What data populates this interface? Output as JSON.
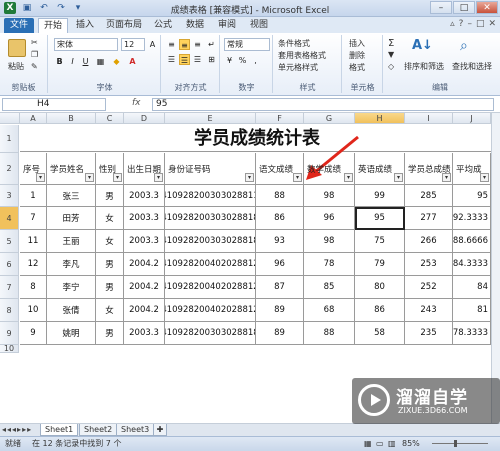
{
  "window": {
    "title": "成绩表格 [兼容模式] - Microsoft Excel",
    "minimize": "–",
    "restore": "□",
    "close": "✕"
  },
  "tabs": [
    "文件",
    "开始",
    "插入",
    "页面布局",
    "公式",
    "数据",
    "审阅",
    "视图"
  ],
  "ribbon": {
    "paste_label": "粘贴",
    "clipboard_group": "剪贴板",
    "font_name": "宋体",
    "font_size": "12",
    "font_group": "字体",
    "align_group": "对齐方式",
    "number_format": "常规",
    "number_group": "数字",
    "styles": [
      "条件格式",
      "套用表格格式",
      "单元格样式"
    ],
    "styles_group": "样式",
    "cells": [
      "插入",
      "删除",
      "格式"
    ],
    "cells_group": "单元格",
    "sort_label": "排序和筛选",
    "find_label": "查找和选择",
    "edit_group": "编辑"
  },
  "formula_bar": {
    "cell_ref": "H4",
    "fx": "fx",
    "value": "95"
  },
  "sheet": {
    "col_letters": [
      "A",
      "B",
      "C",
      "D",
      "E",
      "F",
      "G",
      "H",
      "I",
      "J"
    ],
    "row_numbers": [
      "1",
      "2",
      "3",
      "4",
      "5",
      "6",
      "7",
      "8",
      "9",
      "10"
    ],
    "title": "学员成绩统计表",
    "headers": [
      "序号",
      "学员姓名",
      "性别",
      "出生日期",
      "身份证号码",
      "语文成绩",
      "数学成绩",
      "英语成绩",
      "学员总成绩",
      "平均成"
    ],
    "rows": [
      [
        "1",
        "张三",
        "男",
        "2003.3",
        "410928200303028811",
        "88",
        "98",
        "99",
        "285",
        "95"
      ],
      [
        "7",
        "田芳",
        "女",
        "2003.3",
        "410928200303028818",
        "86",
        "96",
        "95",
        "277",
        "92.3333"
      ],
      [
        "11",
        "王丽",
        "女",
        "2003.3",
        "410928200303028818",
        "93",
        "98",
        "75",
        "266",
        "88.6666"
      ],
      [
        "12",
        "李凡",
        "男",
        "2004.2",
        "410928200402028812",
        "96",
        "78",
        "79",
        "253",
        "84.3333"
      ],
      [
        "8",
        "李宁",
        "男",
        "2004.2",
        "410928200402028812",
        "87",
        "85",
        "80",
        "252",
        "84"
      ],
      [
        "10",
        "张倩",
        "女",
        "2004.2",
        "410928200402028812",
        "89",
        "68",
        "86",
        "243",
        "81"
      ],
      [
        "9",
        "姚明",
        "男",
        "2003.3",
        "410928200303028818",
        "89",
        "88",
        "58",
        "235",
        "78.3333"
      ]
    ]
  },
  "sheet_tabs": [
    "Sheet1",
    "Sheet2",
    "Sheet3"
  ],
  "status": {
    "ready": "就绪",
    "message": "在 12 条记录中找到 7 个",
    "zoom": "85%"
  },
  "watermark": {
    "title": "溜溜自学",
    "url": "ZIXUE.3D66.COM"
  }
}
